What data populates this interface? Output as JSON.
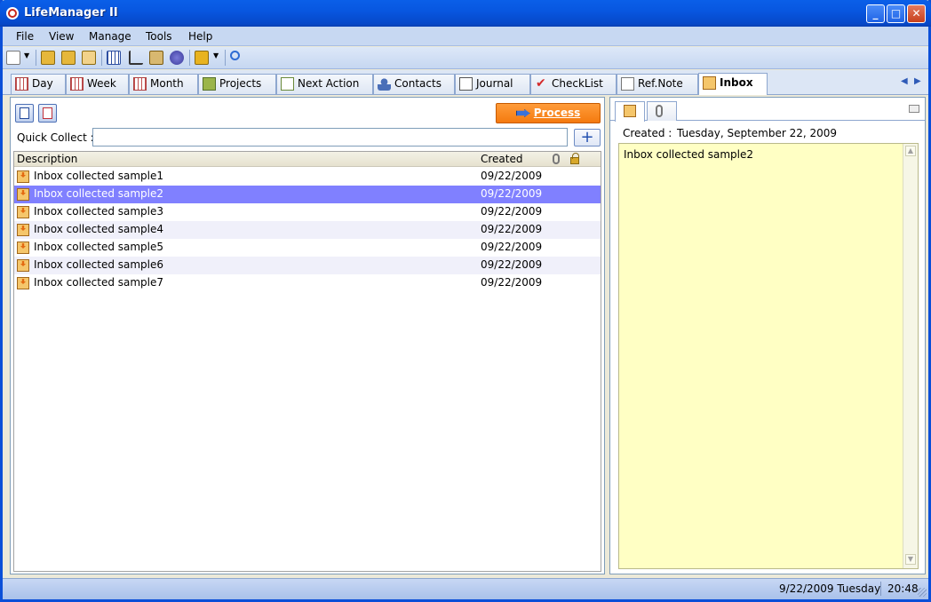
{
  "window": {
    "title": "LifeManager II"
  },
  "menu": [
    "File",
    "View",
    "Manage",
    "Tools",
    "Help"
  ],
  "tabs": [
    {
      "label": "Day",
      "icon": "calendar-day-icon"
    },
    {
      "label": "Week",
      "icon": "calendar-week-icon"
    },
    {
      "label": "Month",
      "icon": "calendar-month-icon"
    },
    {
      "label": "Projects",
      "icon": "projects-icon"
    },
    {
      "label": "Next Action",
      "icon": "next-action-icon"
    },
    {
      "label": "Contacts",
      "icon": "contacts-icon"
    },
    {
      "label": "Journal",
      "icon": "journal-icon"
    },
    {
      "label": "CheckList",
      "icon": "checklist-icon"
    },
    {
      "label": "Ref.Note",
      "icon": "ref-note-icon"
    },
    {
      "label": "Inbox",
      "icon": "inbox-icon",
      "active": true
    }
  ],
  "inbox": {
    "process_label": "Process",
    "quick_collect_label": "Quick Collect :",
    "quick_collect_value": "",
    "add_label": "+",
    "columns": {
      "description": "Description",
      "created": "Created"
    },
    "rows": [
      {
        "description": "Inbox collected sample1",
        "created": "09/22/2009"
      },
      {
        "description": "Inbox collected sample2",
        "created": "09/22/2009",
        "selected": true
      },
      {
        "description": "Inbox collected sample3",
        "created": "09/22/2009"
      },
      {
        "description": "Inbox collected sample4",
        "created": "09/22/2009"
      },
      {
        "description": "Inbox collected sample5",
        "created": "09/22/2009"
      },
      {
        "description": "Inbox collected sample6",
        "created": "09/22/2009"
      },
      {
        "description": "Inbox collected sample7",
        "created": "09/22/2009"
      }
    ]
  },
  "detail": {
    "created_label": "Created :",
    "created_value": "Tuesday, September 22, 2009",
    "note_text": "Inbox collected sample2"
  },
  "status": {
    "date": "9/22/2009 Tuesday",
    "time": "20:48"
  },
  "colors": {
    "selection": "#8080ff",
    "process_button": "#f47a0f",
    "note_background": "#ffffc4"
  }
}
